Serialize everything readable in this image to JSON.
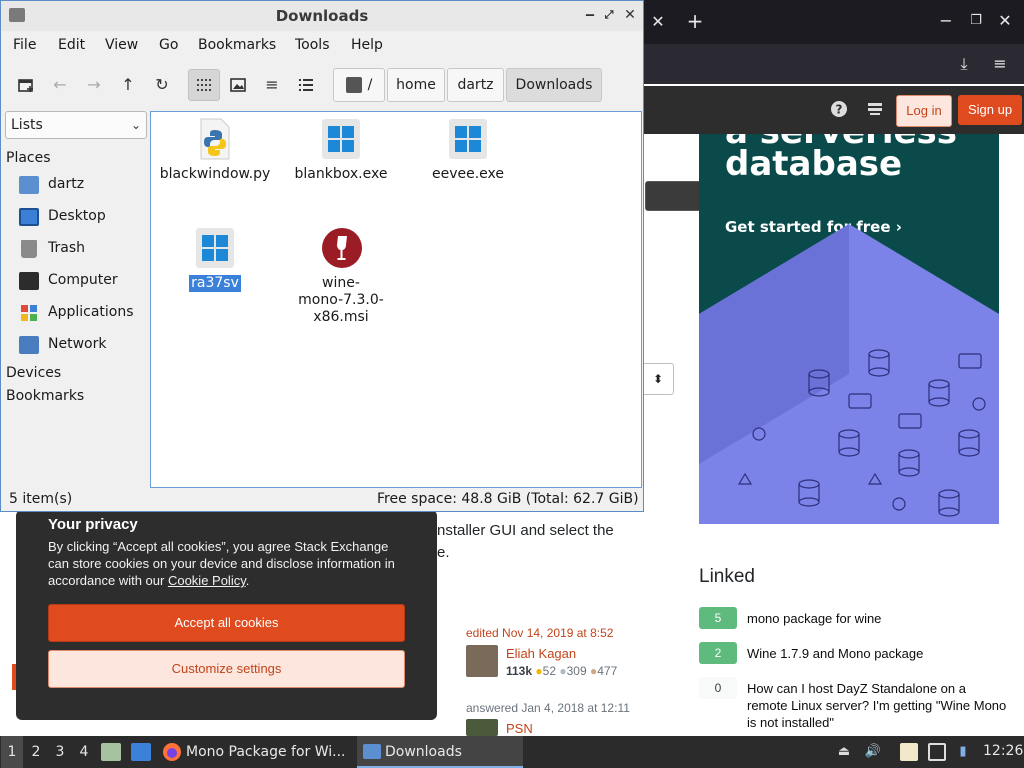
{
  "file_manager": {
    "title": "Downloads",
    "window_controls": [
      "minimize",
      "maximize",
      "close"
    ],
    "menu": [
      "File",
      "Edit",
      "View",
      "Go",
      "Bookmarks",
      "Tools",
      "Help"
    ],
    "path": [
      "/",
      "home",
      "dartz",
      "Downloads"
    ],
    "sidebar_select": "Lists",
    "sidebar": {
      "places_heading": "Places",
      "places": [
        {
          "label": "dartz",
          "icon": "home-folder-icon"
        },
        {
          "label": "Desktop",
          "icon": "desktop-icon"
        },
        {
          "label": "Trash",
          "icon": "trash-icon"
        },
        {
          "label": "Computer",
          "icon": "computer-icon"
        },
        {
          "label": "Applications",
          "icon": "applications-icon"
        },
        {
          "label": "Network",
          "icon": "network-icon"
        }
      ],
      "devices_heading": "Devices",
      "bookmarks_heading": "Bookmarks"
    },
    "files": [
      {
        "name": "blackwindow.py",
        "type": "python"
      },
      {
        "name": "blankbox.exe",
        "type": "exe"
      },
      {
        "name": "eevee.exe",
        "type": "exe"
      },
      {
        "name": "ra37sv",
        "type": "exe",
        "selected": true
      },
      {
        "name": "wine-mono-7.3.0-x86.msi",
        "name_lines": [
          "wine-",
          "mono-7.3.0-",
          "x86.msi"
        ],
        "type": "msi"
      }
    ],
    "status_left": "5 item(s)",
    "status_right": "Free space: 48.8 GiB (Total: 62.7 GiB)"
  },
  "browser": {
    "new_tab": "+",
    "window_controls": [
      "minimize",
      "maximize",
      "close"
    ],
    "header": {
      "login": "Log in",
      "signup": "Sign up"
    },
    "ad": {
      "title_top": "a serverless",
      "title": "database",
      "cta": "Get started for free ›"
    },
    "page_text_lines": [
      "nstaller GUI and select the",
      "e."
    ],
    "post": {
      "edited": "edited Nov 14, 2019 at 8:52",
      "editor": "Eliah Kagan",
      "editor_rep": "113k",
      "gold": "52",
      "silver": "309",
      "bronze": "477",
      "answered": "answered Jan 4, 2018 at 12:11",
      "answerer": "PSN"
    },
    "linked": {
      "title": "Linked",
      "items": [
        {
          "count": "5",
          "text": "mono package for wine",
          "accepted": true
        },
        {
          "count": "2",
          "text": "Wine 1.7.9 and Mono package",
          "accepted": true
        },
        {
          "count": "0",
          "text": "How can I host DayZ Standalone on a remote Linux server? I'm getting \"Wine Mono is not installed\"",
          "accepted": false
        }
      ]
    },
    "cookie": {
      "title": "Your privacy",
      "body_before": "By clicking “Accept all cookies”, you agree Stack Exchange can store cookies on your device and disclose information in accordance with our ",
      "link": "Cookie Policy",
      "body_after": ".",
      "accept": "Accept all cookies",
      "customize": "Customize settings"
    }
  },
  "taskbar": {
    "workspaces": [
      "1",
      "2",
      "3",
      "4"
    ],
    "active_workspace": "1",
    "tasks": [
      {
        "label": "Mono Package for Wi...",
        "icon": "firefox-icon"
      },
      {
        "label": "Downloads",
        "icon": "folder-icon",
        "active": true
      }
    ],
    "clock": "12:26"
  },
  "colors": {
    "accent": "#3b80d9",
    "so_orange": "#e04a1f",
    "linked_green": "#5eba7d"
  }
}
